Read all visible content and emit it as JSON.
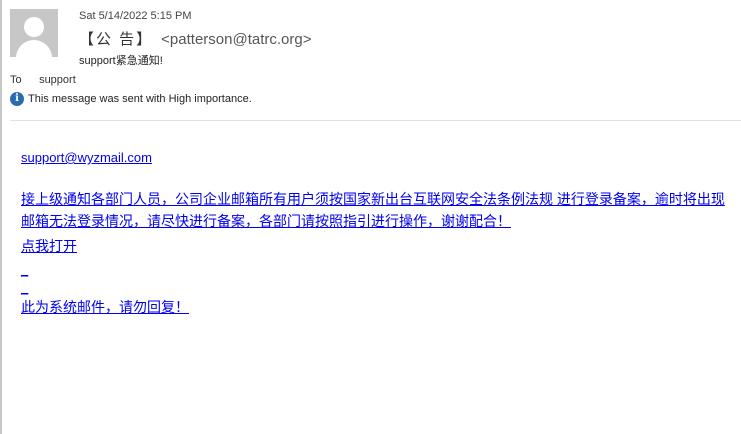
{
  "header": {
    "date": "Sat 5/14/2022 5:15 PM",
    "sender_name": "【公 告】",
    "sender_email": "<patterson@tatrc.org>",
    "subject": "support紧急通知!",
    "to_label": "To",
    "to_value": "support",
    "importance_text": "This message was sent with High importance.",
    "avatar_icon": "person-silhouette-icon",
    "importance_icon": "info-icon"
  },
  "body": {
    "from_link": "support@wyzmail.com",
    "notice_text": "接上级通知各部门人员，公司企业邮箱所有用户须按国家新出台互联网安全法条例法规 进行登录备案，逾时将出现邮箱无法登录情况，请尽快进行备案，各部门请按照指引进行操作，谢谢配合！",
    "click_link": "点我打开",
    "footer_text": "此为系统邮件，请勿回复！"
  },
  "colors": {
    "link": "#0000ee",
    "info_icon": "#2b6cb0",
    "avatar_bg": "#c7c7c7"
  }
}
